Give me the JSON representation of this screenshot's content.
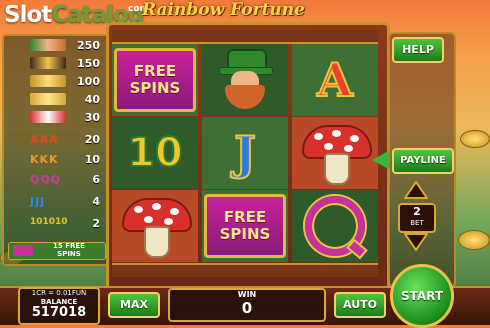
{
  "branding": {
    "site_logo_part1": "Slot",
    "site_logo_part2": "Catalog",
    "site_logo_com": "com",
    "game_title": "Rainbow Fortune"
  },
  "paytable": [
    {
      "symbol": "leprechaun",
      "payout": "250"
    },
    {
      "symbol": "pot-of-gold",
      "payout": "150"
    },
    {
      "symbol": "golden-horseshoe",
      "payout": "100"
    },
    {
      "symbol": "gold-coins",
      "payout": "40"
    },
    {
      "symbol": "mushroom",
      "payout": "30"
    },
    {
      "symbol": "AAA",
      "payout": "20",
      "color": "#e24a1a"
    },
    {
      "symbol": "KKK",
      "payout": "10",
      "color": "#e89a2a"
    },
    {
      "symbol": "QQQ",
      "payout": "6",
      "color": "#c83aa0"
    },
    {
      "symbol": "JJJ",
      "payout": "4",
      "color": "#2a8ae8"
    },
    {
      "symbol": "101010",
      "payout": "2",
      "color": "#e8c22a"
    }
  ],
  "paytable_free": {
    "line1": "15 FREE",
    "line2": "SPINS"
  },
  "reels": {
    "free_spins_line1": "FREE",
    "free_spins_line2": "SPINS",
    "letter_a": "A",
    "letter_j": "J",
    "letter_q": "Q",
    "ten": "10"
  },
  "controls": {
    "help": "HELP",
    "payline": "PAYLINE",
    "bet_value": "2",
    "bet_label": "BET",
    "start": "START",
    "max": "MAX",
    "auto": "AUTO"
  },
  "balance": {
    "credit_rate": "1CR = 0.01FUN",
    "label": "BALANCE",
    "value": "517018"
  },
  "win": {
    "label": "WIN",
    "value": "0"
  },
  "colors": {
    "accent_gold": "#d8a63a",
    "button_green": "#3fb23a",
    "free_spins_magenta": "#c8229a"
  }
}
